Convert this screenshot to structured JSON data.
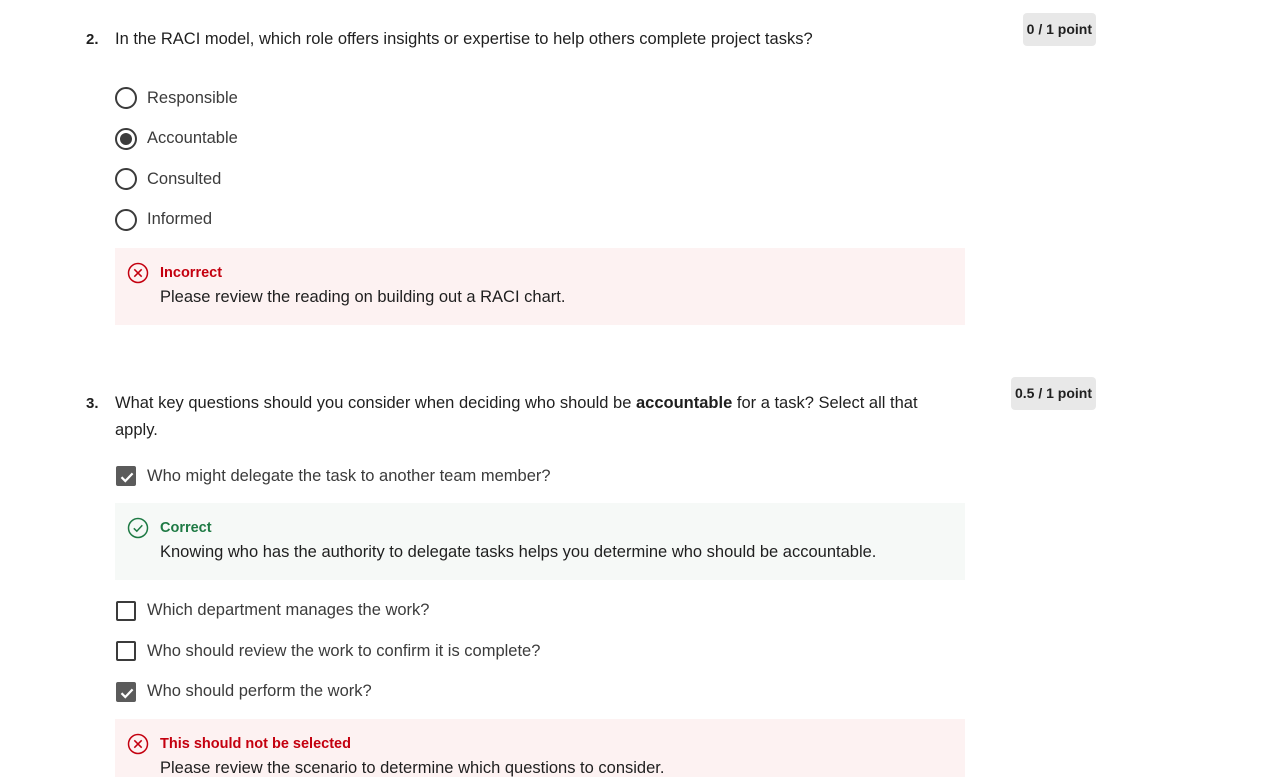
{
  "q2": {
    "number": "2.",
    "text": "In the RACI model, which role offers insights or expertise to help others complete project tasks?",
    "points": "0 / 1 point",
    "options": [
      {
        "label": "Responsible",
        "selected": false
      },
      {
        "label": "Accountable",
        "selected": true
      },
      {
        "label": "Consulted",
        "selected": false
      },
      {
        "label": "Informed",
        "selected": false
      }
    ],
    "feedback": {
      "status": "Incorrect",
      "icon": "x-circle-icon",
      "color": "#c4000f",
      "message": "Please review the reading on building out a RACI chart."
    }
  },
  "q3": {
    "number": "3.",
    "text_before": "What key questions should you consider when deciding who should be ",
    "text_bold": "accountable",
    "text_after": " for a task? Select all that apply.",
    "points": "0.5 / 1 point",
    "options": [
      {
        "label": "Who might delegate the task to another team member?",
        "checked": true
      },
      {
        "label": "Which department manages the work?",
        "checked": false
      },
      {
        "label": "Who should review the work to confirm it is complete?",
        "checked": false
      },
      {
        "label": "Who should perform the work?",
        "checked": true
      }
    ],
    "feedback_correct": {
      "status": "Correct",
      "icon": "check-circle-icon",
      "color": "#1e7a44",
      "message": "Knowing who has the authority to delegate tasks helps you determine who should be accountable."
    },
    "feedback_incorrect": {
      "status": "This should not be selected",
      "icon": "x-circle-icon",
      "color": "#c4000f",
      "message": "Please review the scenario to determine which questions to consider."
    }
  }
}
